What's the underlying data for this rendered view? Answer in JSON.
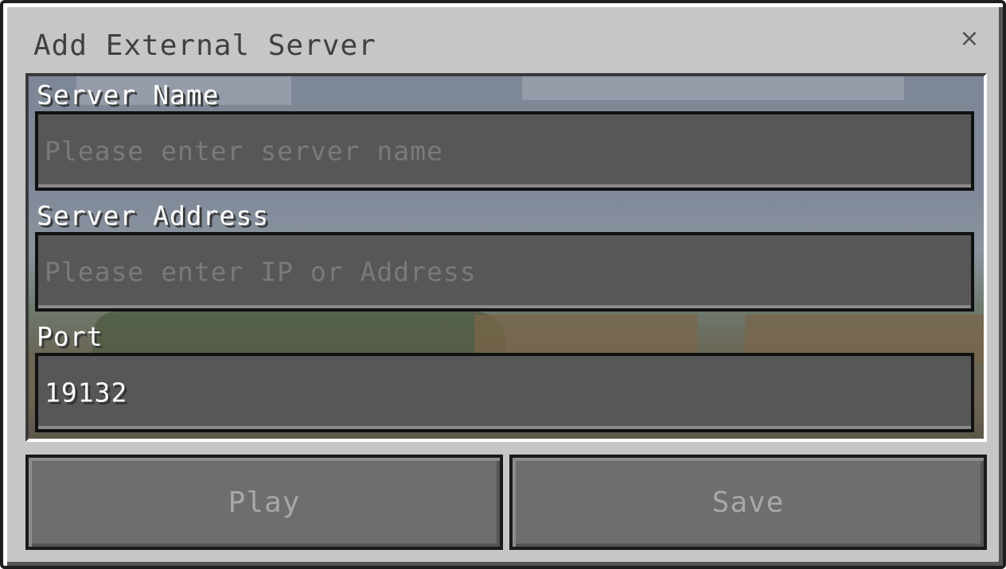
{
  "dialog": {
    "title": "Add External Server",
    "close_label": "×"
  },
  "fields": {
    "server_name": {
      "label": "Server Name",
      "value": "",
      "placeholder": "Please enter server name"
    },
    "server_address": {
      "label": "Server Address",
      "value": "",
      "placeholder": "Please enter IP or Address"
    },
    "port": {
      "label": "Port",
      "value": "19132",
      "placeholder": ""
    }
  },
  "buttons": {
    "play_label": "Play",
    "save_label": "Save"
  },
  "colors": {
    "dialog_bg": "#c6c6c6",
    "field_bg": "#575757",
    "button_bg": "#6e6e6e",
    "disabled_text": "#a8a8a8"
  },
  "icons": {
    "close": "close-icon"
  }
}
